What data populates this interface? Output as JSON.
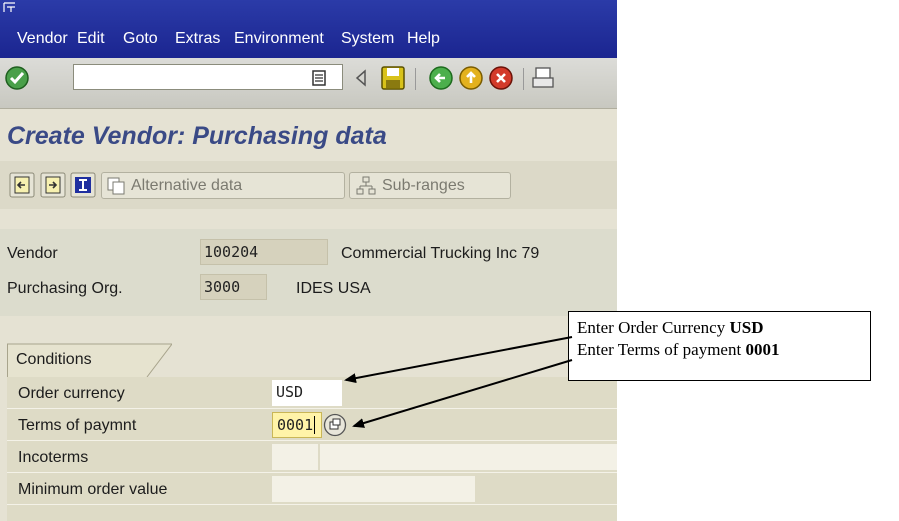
{
  "menu": {
    "items": [
      "Vendor",
      "Edit",
      "Goto",
      "Extras",
      "Environment",
      "System",
      "Help"
    ]
  },
  "toolbar": {
    "command_value": "",
    "icons": [
      "enter-icon",
      "history-icon",
      "back-triangle-icon",
      "save-icon",
      "back-icon",
      "exit-icon",
      "cancel-icon",
      "print-icon"
    ]
  },
  "title": "Create Vendor: Purchasing data",
  "appbar": {
    "alternative_data": "Alternative data",
    "sub_ranges": "Sub-ranges"
  },
  "header": {
    "vendor_label": "Vendor",
    "vendor_value": "100204",
    "vendor_name": "Commercial Trucking Inc 79",
    "porg_label": "Purchasing Org.",
    "porg_value": "3000",
    "porg_name": "IDES USA"
  },
  "tab": {
    "label": "Conditions"
  },
  "conditions": {
    "order_currency_label": "Order currency",
    "order_currency_value": "USD",
    "terms_label": "Terms of paymnt",
    "terms_value": "0001",
    "incoterms_label": "Incoterms",
    "incoterms_value": "",
    "incoterms_value2": "",
    "min_order_label": "Minimum order value",
    "min_order_value": ""
  },
  "annotation": {
    "line1_text": "Enter Order Currency ",
    "line1_bold": "USD",
    "line2_text": "Enter Terms of payment ",
    "line2_bold": "0001"
  },
  "colors": {
    "menubar": "#1b2590",
    "title": "#3a4a86",
    "highlight_field": "#fff3a8"
  }
}
